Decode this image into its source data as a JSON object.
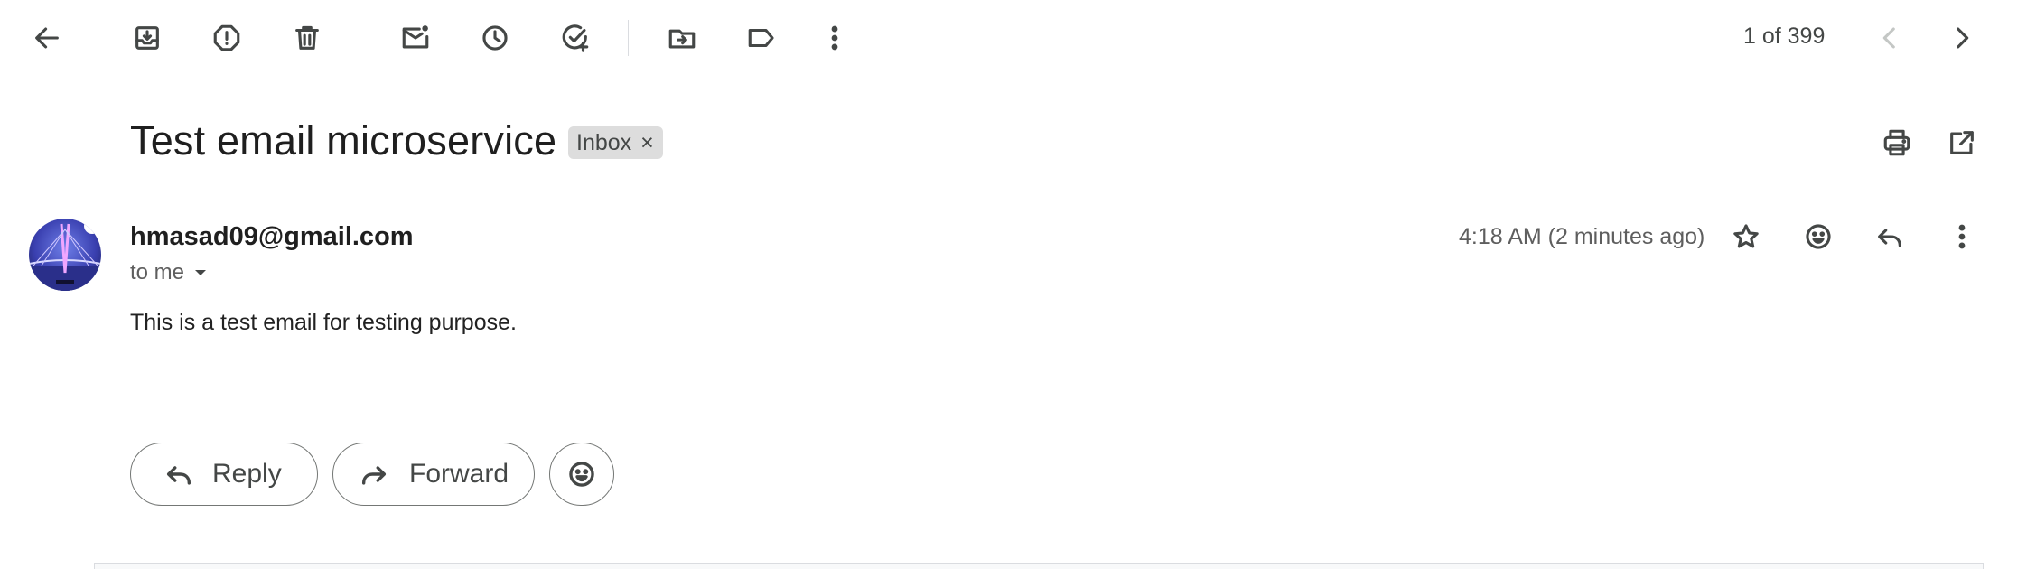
{
  "toolbar": {
    "back": "back-arrow-icon",
    "archive": "archive-icon",
    "spam": "report-spam-icon",
    "delete": "trash-icon",
    "mark_unread": "mark-unread-icon",
    "snooze": "snooze-clock-icon",
    "add_task": "add-task-icon",
    "move_to": "move-to-folder-icon",
    "labels": "label-icon",
    "more": "more-vert-icon"
  },
  "pager": {
    "text": "1 of 399"
  },
  "subject": {
    "title": "Test email microservice",
    "label": "Inbox",
    "label_close": "×"
  },
  "message": {
    "sender": "hmasad09@gmail.com",
    "recipient": "to me",
    "time": "4:18 AM (2 minutes ago)",
    "body": "This is a test email for testing purpose."
  },
  "actions": {
    "reply": "Reply",
    "forward": "Forward"
  },
  "colors": {
    "icon": "#444746",
    "chip": "#dddddd",
    "text": "#1f1f1f",
    "muted": "#5e5e5e"
  }
}
